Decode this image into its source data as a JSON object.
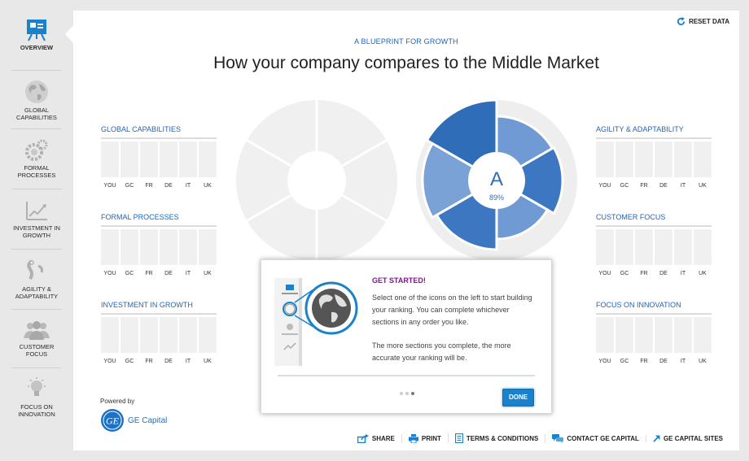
{
  "sidebar": {
    "items": [
      {
        "label": "Overview",
        "icon": "presentation-board-icon"
      },
      {
        "label": "Global Capabilities",
        "icon": "globe-icon"
      },
      {
        "label": "Formal Processes",
        "icon": "gears-icon"
      },
      {
        "label": "Investment in Growth",
        "icon": "growth-chart-icon"
      },
      {
        "label": "Agility & Adaptability",
        "icon": "flexible-pipe-icon"
      },
      {
        "label": "Customer Focus",
        "icon": "people-group-icon"
      },
      {
        "label": "Focus on Innovation",
        "icon": "lightbulb-icon"
      }
    ]
  },
  "header": {
    "reset_label": "RESET DATA",
    "subtitle": "A BLUEPRINT FOR GROWTH",
    "title": "How your company compares to the Middle Market"
  },
  "categories_left": [
    {
      "name": "GLOBAL CAPABILITIES"
    },
    {
      "name": "FORMAL PROCESSES"
    },
    {
      "name": "INVESTMENT IN GROWTH"
    }
  ],
  "categories_right": [
    {
      "name": "AGILITY & ADAPTABILITY"
    },
    {
      "name": "CUSTOMER FOCUS"
    },
    {
      "name": "FOCUS ON INNOVATION"
    }
  ],
  "comparison_labels": [
    "YOU",
    "GC",
    "FR",
    "DE",
    "IT",
    "UK"
  ],
  "result": {
    "grade": "A",
    "percent": "89%"
  },
  "modal": {
    "title": "GET STARTED!",
    "paragraph1": "Select one of the icons on the left to start building your ranking. You can complete whichever sections in any order you like.",
    "paragraph2": "The more sections you complete, the more accurate your ranking will be.",
    "done_label": "DONE",
    "page_count": 3,
    "active_page": 3
  },
  "powered": {
    "label": "Powered by",
    "brand": "GE Capital"
  },
  "footer": {
    "links": [
      "SHARE",
      "PRINT",
      "TERMS & CONDITIONS",
      "CONTACT GE CAPITAL",
      "GE CAPITAL SITES"
    ]
  },
  "colors": {
    "accent": "#1f64b8",
    "modal_title": "#7a1a86",
    "done_button": "#1a82cc"
  }
}
